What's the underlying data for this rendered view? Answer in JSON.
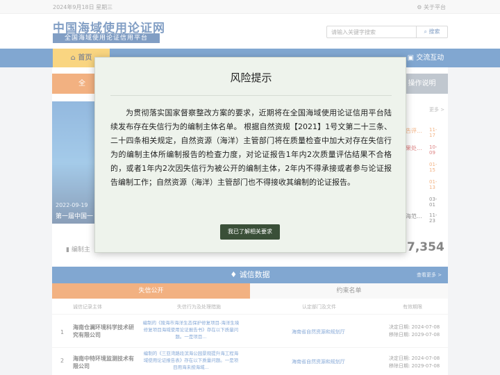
{
  "topbar": {
    "date": "2024年9月18日 星期三",
    "about": "关于平台"
  },
  "header": {
    "logo_main": "中国海域使用论证网",
    "logo_sub": "全国海域使用论证信用平台",
    "search_placeholder": "请输入关键字搜索",
    "search_button": "搜索"
  },
  "nav": {
    "items": [
      "首页",
      "交流互动"
    ]
  },
  "main": {
    "orange_label": "全",
    "gray_button": "操作说明",
    "banner_date": "2022-09-19",
    "banner_title": "第一届中国一",
    "news_more": "更多 >",
    "news": [
      {
        "title": "告评...",
        "date": "11-17",
        "color": "#e8711a"
      },
      {
        "title": "果处...",
        "date": "10-09",
        "color": "#c01818"
      },
      {
        "title": "",
        "date": "01-15",
        "color": "#e8711a"
      },
      {
        "title": "",
        "date": "01-13",
        "color": "#e8711a"
      },
      {
        "title": "",
        "date": "03-01",
        "color": "#333333"
      },
      {
        "title": "海范...",
        "date": "11-23",
        "color": "#333333"
      }
    ],
    "stat_label": "编制主",
    "stat_value": "7,354"
  },
  "credit": {
    "title": "诚信数据",
    "more": "查看更多 >",
    "tab_active": "失信公开",
    "tab_other": "约束名单",
    "columns": [
      "诚信记录主体",
      "失信行为及处理措施",
      "认定部门及文件",
      "有效期限"
    ],
    "rows": [
      {
        "num": "1",
        "org": "海南仓澜环境科学技术研究有限公司",
        "behavior": "编制的《陵海市海洋生态保护修复项目-海洋生境修复项目海域使用论证报告书》存在以下质量问题。一是项目...",
        "dept": "海南省自然资源和规划厅",
        "period_start": "决定日期: 2024-07-08",
        "period_end": "移除日期: 2029-07-08"
      },
      {
        "num": "2",
        "org": "海南中特环境监测技术有限公司",
        "behavior": "编制的《三亚湾路段滨海公园景观提升海工程海域使用论证报告表》存在以下质量问题。一是项目用海未按海域...",
        "dept": "海南省自然资源和规划厅",
        "period_start": "决定日期: 2024-07-08",
        "period_end": "移除日期: 2029-07-08"
      }
    ]
  },
  "modal": {
    "title": "风险提示",
    "body": "为贯彻落实国家督察整改方案的要求，近期将在全国海域使用论证信用平台陆续发布存在失信行为的编制主体名单。 根据自然资规【2021】1号文第二十三条、二十四条相关规定，自然资源（海洋）主管部门将在质量检查中加大对存在失信行为的编制主体所编制报告的检查力度，对论证报告1年内2次质量评估结果不合格的，或者1年内2次因失信行为被公开的编制主体，2年内不得承接或者参与论证报告编制工作；自然资源（海洋）主管部门也不得接收其编制的论证报告。",
    "confirm_button": "我已了解相关要求"
  }
}
